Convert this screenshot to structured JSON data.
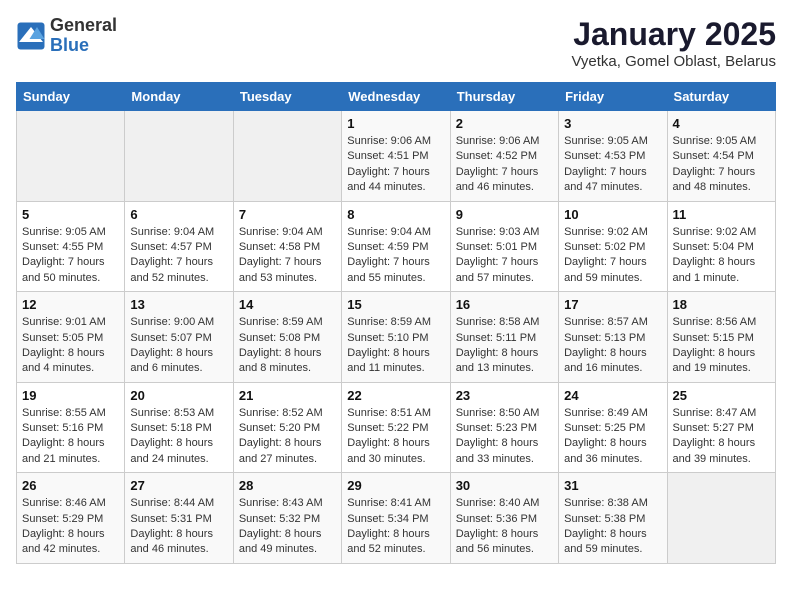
{
  "logo": {
    "general": "General",
    "blue": "Blue"
  },
  "title": "January 2025",
  "subtitle": "Vyetka, Gomel Oblast, Belarus",
  "days_header": [
    "Sunday",
    "Monday",
    "Tuesday",
    "Wednesday",
    "Thursday",
    "Friday",
    "Saturday"
  ],
  "weeks": [
    [
      {
        "day": "",
        "info": ""
      },
      {
        "day": "",
        "info": ""
      },
      {
        "day": "",
        "info": ""
      },
      {
        "day": "1",
        "info": "Sunrise: 9:06 AM\nSunset: 4:51 PM\nDaylight: 7 hours\nand 44 minutes."
      },
      {
        "day": "2",
        "info": "Sunrise: 9:06 AM\nSunset: 4:52 PM\nDaylight: 7 hours\nand 46 minutes."
      },
      {
        "day": "3",
        "info": "Sunrise: 9:05 AM\nSunset: 4:53 PM\nDaylight: 7 hours\nand 47 minutes."
      },
      {
        "day": "4",
        "info": "Sunrise: 9:05 AM\nSunset: 4:54 PM\nDaylight: 7 hours\nand 48 minutes."
      }
    ],
    [
      {
        "day": "5",
        "info": "Sunrise: 9:05 AM\nSunset: 4:55 PM\nDaylight: 7 hours\nand 50 minutes."
      },
      {
        "day": "6",
        "info": "Sunrise: 9:04 AM\nSunset: 4:57 PM\nDaylight: 7 hours\nand 52 minutes."
      },
      {
        "day": "7",
        "info": "Sunrise: 9:04 AM\nSunset: 4:58 PM\nDaylight: 7 hours\nand 53 minutes."
      },
      {
        "day": "8",
        "info": "Sunrise: 9:04 AM\nSunset: 4:59 PM\nDaylight: 7 hours\nand 55 minutes."
      },
      {
        "day": "9",
        "info": "Sunrise: 9:03 AM\nSunset: 5:01 PM\nDaylight: 7 hours\nand 57 minutes."
      },
      {
        "day": "10",
        "info": "Sunrise: 9:02 AM\nSunset: 5:02 PM\nDaylight: 7 hours\nand 59 minutes."
      },
      {
        "day": "11",
        "info": "Sunrise: 9:02 AM\nSunset: 5:04 PM\nDaylight: 8 hours\nand 1 minute."
      }
    ],
    [
      {
        "day": "12",
        "info": "Sunrise: 9:01 AM\nSunset: 5:05 PM\nDaylight: 8 hours\nand 4 minutes."
      },
      {
        "day": "13",
        "info": "Sunrise: 9:00 AM\nSunset: 5:07 PM\nDaylight: 8 hours\nand 6 minutes."
      },
      {
        "day": "14",
        "info": "Sunrise: 8:59 AM\nSunset: 5:08 PM\nDaylight: 8 hours\nand 8 minutes."
      },
      {
        "day": "15",
        "info": "Sunrise: 8:59 AM\nSunset: 5:10 PM\nDaylight: 8 hours\nand 11 minutes."
      },
      {
        "day": "16",
        "info": "Sunrise: 8:58 AM\nSunset: 5:11 PM\nDaylight: 8 hours\nand 13 minutes."
      },
      {
        "day": "17",
        "info": "Sunrise: 8:57 AM\nSunset: 5:13 PM\nDaylight: 8 hours\nand 16 minutes."
      },
      {
        "day": "18",
        "info": "Sunrise: 8:56 AM\nSunset: 5:15 PM\nDaylight: 8 hours\nand 19 minutes."
      }
    ],
    [
      {
        "day": "19",
        "info": "Sunrise: 8:55 AM\nSunset: 5:16 PM\nDaylight: 8 hours\nand 21 minutes."
      },
      {
        "day": "20",
        "info": "Sunrise: 8:53 AM\nSunset: 5:18 PM\nDaylight: 8 hours\nand 24 minutes."
      },
      {
        "day": "21",
        "info": "Sunrise: 8:52 AM\nSunset: 5:20 PM\nDaylight: 8 hours\nand 27 minutes."
      },
      {
        "day": "22",
        "info": "Sunrise: 8:51 AM\nSunset: 5:22 PM\nDaylight: 8 hours\nand 30 minutes."
      },
      {
        "day": "23",
        "info": "Sunrise: 8:50 AM\nSunset: 5:23 PM\nDaylight: 8 hours\nand 33 minutes."
      },
      {
        "day": "24",
        "info": "Sunrise: 8:49 AM\nSunset: 5:25 PM\nDaylight: 8 hours\nand 36 minutes."
      },
      {
        "day": "25",
        "info": "Sunrise: 8:47 AM\nSunset: 5:27 PM\nDaylight: 8 hours\nand 39 minutes."
      }
    ],
    [
      {
        "day": "26",
        "info": "Sunrise: 8:46 AM\nSunset: 5:29 PM\nDaylight: 8 hours\nand 42 minutes."
      },
      {
        "day": "27",
        "info": "Sunrise: 8:44 AM\nSunset: 5:31 PM\nDaylight: 8 hours\nand 46 minutes."
      },
      {
        "day": "28",
        "info": "Sunrise: 8:43 AM\nSunset: 5:32 PM\nDaylight: 8 hours\nand 49 minutes."
      },
      {
        "day": "29",
        "info": "Sunrise: 8:41 AM\nSunset: 5:34 PM\nDaylight: 8 hours\nand 52 minutes."
      },
      {
        "day": "30",
        "info": "Sunrise: 8:40 AM\nSunset: 5:36 PM\nDaylight: 8 hours\nand 56 minutes."
      },
      {
        "day": "31",
        "info": "Sunrise: 8:38 AM\nSunset: 5:38 PM\nDaylight: 8 hours\nand 59 minutes."
      },
      {
        "day": "",
        "info": ""
      }
    ]
  ]
}
